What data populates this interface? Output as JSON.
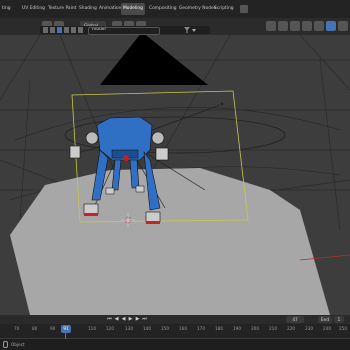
{
  "workspaces": [
    "ting",
    "UV Editing",
    "Texture Paint",
    "Shading",
    "Animation",
    "Modeling",
    "Compositing",
    "Geometry Nodes",
    "Scripting"
  ],
  "active_workspace": "Modeling",
  "header": {
    "transform_orientation": "Global",
    "search_value": "model"
  },
  "timeline": {
    "current_frame": "91",
    "frame_field": "47",
    "end_field": "End",
    "end_value": "1",
    "ruler_ticks": [
      "70",
      "80",
      "90",
      "",
      "110",
      "120",
      "130",
      "140",
      "150",
      "160",
      "170",
      "180",
      "190",
      "200",
      "210",
      "220",
      "230",
      "240",
      "250"
    ]
  },
  "status": {
    "label": "Object"
  },
  "colors": {
    "robot_body": "#2f6fc4",
    "ground": "#a7a7a7",
    "selection_outline": "#c8c850",
    "active_tab": "#4a4a4a",
    "accent": "#4772b3"
  }
}
